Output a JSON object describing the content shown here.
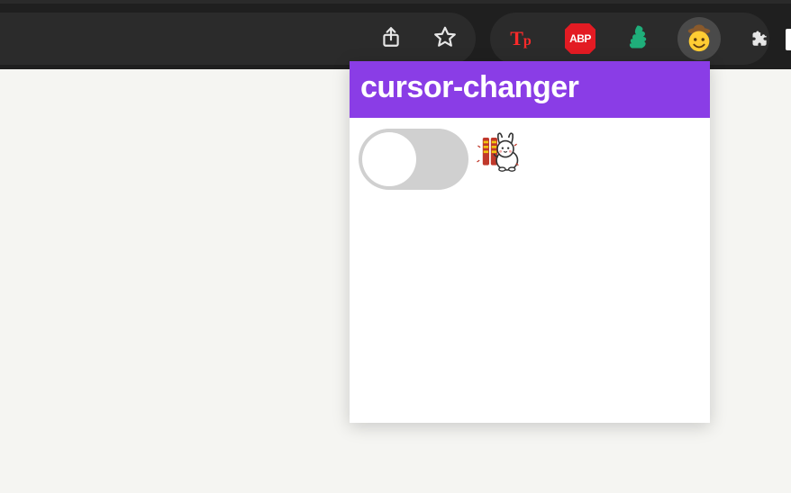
{
  "popup": {
    "title": "cursor-changer",
    "toggle_state": "off",
    "header_color": "#8a3de6"
  },
  "toolbar": {
    "share_label": "Share",
    "bookmark_label": "Bookmark this tab"
  },
  "extensions": {
    "tp_label": "Tp",
    "abp_label": "ABP",
    "flash_label": "Flash control",
    "cowboy_label": "Cursor Changer",
    "puzzle_label": "Extensions",
    "active_extension": "cowboy"
  }
}
